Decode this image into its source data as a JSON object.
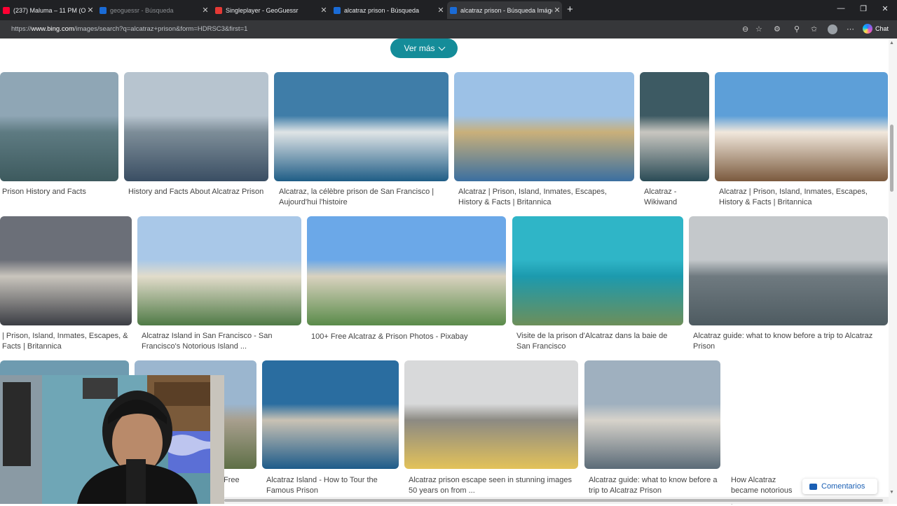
{
  "tabs": [
    {
      "title": "(237) Maluma – 11 PM (Officia",
      "fav": "#ff0033",
      "active": false,
      "dim": false
    },
    {
      "title": "geoguessr - Búsqueda",
      "fav": "#1a6bd6",
      "active": false,
      "dim": true
    },
    {
      "title": "Singleplayer - GeoGuessr",
      "fav": "#e53935",
      "active": false,
      "dim": false
    },
    {
      "title": "alcatraz prison - Búsqueda",
      "fav": "#1a6bd6",
      "active": false,
      "dim": false
    },
    {
      "title": "alcatraz prison - Búsqueda Imágen",
      "fav": "#1a6bd6",
      "active": true,
      "dim": false
    }
  ],
  "address": {
    "prefix": "https://",
    "domain": "www.bing.com",
    "path": "/images/search?q=alcatraz+prison&form=HDRSC3&first=1"
  },
  "chat_label": "Chat",
  "ver_mas": "Ver más",
  "results": [
    {
      "caption": "Prison History and Facts",
      "colors": [
        "#8fa6b5",
        "#5e7b82",
        "#3d5a5e"
      ]
    },
    {
      "caption": "History and Facts About Alcatraz Prison",
      "colors": [
        "#b7c4cf",
        "#7d8d98",
        "#3a4e63"
      ]
    },
    {
      "caption": "Alcatraz, la célèbre prison de San Francisco | Aujourd'hui l'histoire",
      "colors": [
        "#3f7da8",
        "#dfe4e6",
        "#1f5d86"
      ]
    },
    {
      "caption": "Alcatraz | Prison, Island, Inmates, Escapes, History & Facts | Britannica",
      "colors": [
        "#9cc1e6",
        "#c9b07a",
        "#3b6fa0"
      ]
    },
    {
      "caption": "Alcatraz - Wikiwand",
      "colors": [
        "#3d5a63",
        "#c8c6c0",
        "#2a4b56"
      ]
    },
    {
      "caption": "Alcatraz | Prison, Island, Inmates, Escapes, History & Facts | Britannica",
      "colors": [
        "#5d9fd8",
        "#f1e8dc",
        "#7b5a3e"
      ]
    },
    {
      "caption": "| Prison, Island, Inmates, Escapes, & Facts | Britannica",
      "colors": [
        "#6b6f78",
        "#c9c5bd",
        "#3b3d44"
      ]
    },
    {
      "caption": "Alcatraz Island in San Francisco - San Francisco's Notorious Island ...",
      "colors": [
        "#a9c8e8",
        "#e2dccb",
        "#4f7a46"
      ]
    },
    {
      "caption": "100+ Free Alcatraz & Prison Photos - Pixabay",
      "colors": [
        "#6ba8e8",
        "#d9d2bf",
        "#5a8b4a"
      ]
    },
    {
      "caption": "Visite de la prison d'Alcatraz dans la baie de San Francisco",
      "colors": [
        "#2fb5c7",
        "#1c9aae",
        "#6d8f5a"
      ]
    },
    {
      "caption": "Alcatraz guide: what to know before a trip to Alcatraz Prison",
      "colors": [
        "#c4c8cb",
        "#6f7a80",
        "#4e5b61"
      ]
    },
    {
      "caption": "Free",
      "colors": [
        "#6e9bb0",
        "#c9b99a",
        "#4f7a8c"
      ]
    },
    {
      "caption": "Alcatraz Island - How to Tour the Famous Prison",
      "colors": [
        "#9bb6cf",
        "#a89f8e",
        "#5e6f46"
      ]
    },
    {
      "caption": "Alcatraz prison escape seen in stunning images 50 years on from ...",
      "colors": [
        "#2a6da0",
        "#c9c2b4",
        "#1d5b8a"
      ]
    },
    {
      "caption": "Alcatraz guide: what to know before a trip to Alcatraz Prison",
      "colors": [
        "#d8d9da",
        "#8c8a83",
        "#e3c25a"
      ]
    },
    {
      "caption": "How Alcatraz became notorious prison",
      "colors": [
        "#9fb0bf",
        "#d7d3cb",
        "#5b6b78"
      ]
    }
  ],
  "comments_label": "Comentarios"
}
